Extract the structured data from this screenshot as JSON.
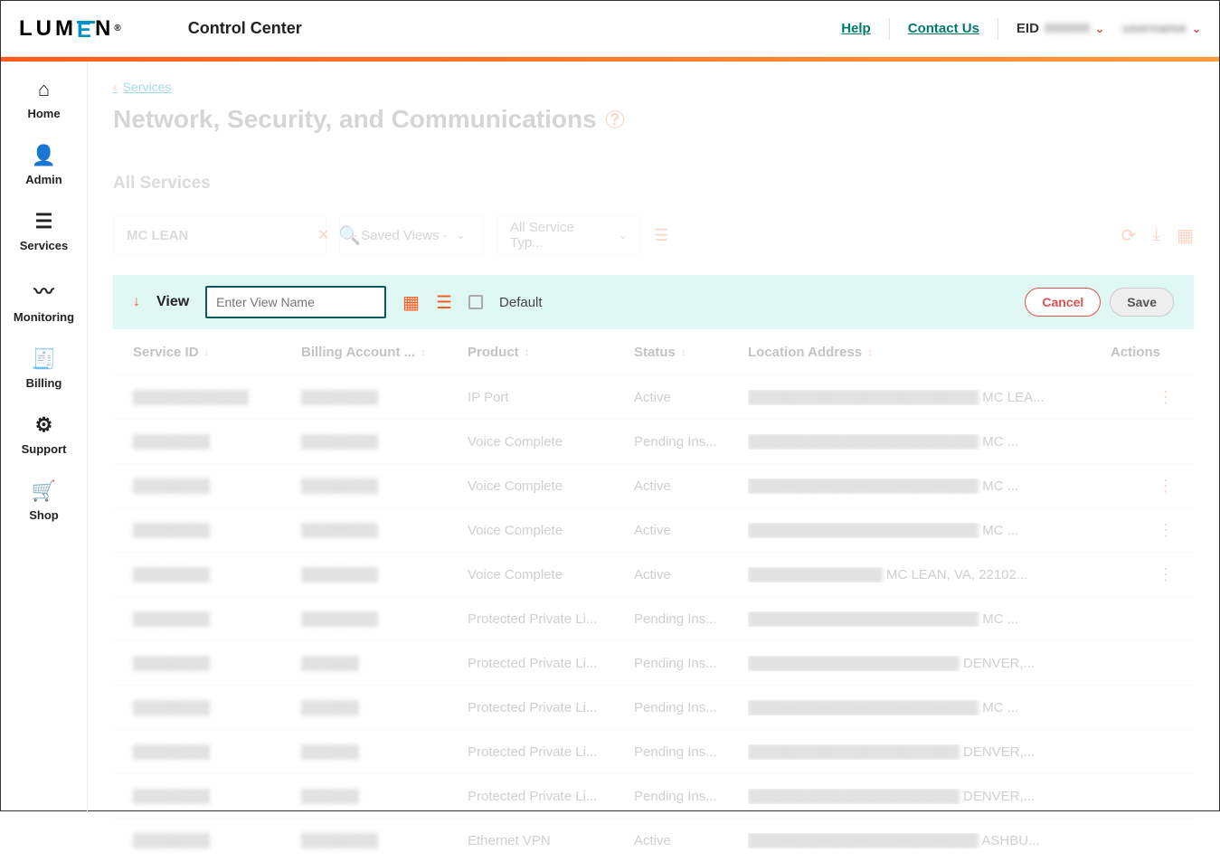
{
  "header": {
    "logo_pre": "LUM",
    "logo_mid": "E",
    "logo_post": "N",
    "app_title": "Control Center",
    "help": "Help",
    "contact": "Contact Us",
    "eid_label": "EID",
    "eid_value": "000000",
    "user_value": "username"
  },
  "sidebar": {
    "items": [
      {
        "icon": "⌂",
        "label": "Home"
      },
      {
        "icon": "👤",
        "label": "Admin"
      },
      {
        "icon": "☰",
        "label": "Services"
      },
      {
        "icon": "〰",
        "label": "Monitoring"
      },
      {
        "icon": "🧾",
        "label": "Billing"
      },
      {
        "icon": "⚙",
        "label": "Support"
      },
      {
        "icon": "🛒",
        "label": "Shop"
      }
    ]
  },
  "breadcrumb": "Services",
  "page_title": "Network, Security, and Communications",
  "section_title": "All Services",
  "filters": {
    "search_value": "MC LEAN",
    "saved_views": "- Saved Views -",
    "service_type": "All Service Typ..."
  },
  "view_bar": {
    "label": "View",
    "placeholder": "Enter View Name",
    "default": "Default",
    "cancel": "Cancel",
    "save": "Save"
  },
  "columns": {
    "sid": "Service ID",
    "ba": "Billing Account ...",
    "prod": "Product",
    "stat": "Status",
    "loc": "Location Address",
    "act": "Actions"
  },
  "rows": [
    {
      "sid": "████████████",
      "ba": "████████",
      "prod": "IP Port",
      "stat": "Active",
      "loc_blur": "████████████████████████",
      "loc": " MC LEA...",
      "dots": true
    },
    {
      "sid": "████████",
      "ba": "████████",
      "prod": "Voice Complete",
      "stat": "Pending Ins...",
      "loc_blur": "████████████████████████",
      "loc": " MC ...",
      "dots": false
    },
    {
      "sid": "████████",
      "ba": "████████",
      "prod": "Voice Complete",
      "stat": "Active",
      "loc_blur": "████████████████████████",
      "loc": " MC ...",
      "dots": true
    },
    {
      "sid": "████████",
      "ba": "████████",
      "prod": "Voice Complete",
      "stat": "Active",
      "loc_blur": "████████████████████████",
      "loc": " MC ...",
      "dots": true
    },
    {
      "sid": "████████",
      "ba": "████████",
      "prod": "Voice Complete",
      "stat": "Active",
      "loc_blur": "██████████████",
      "loc": " MC LEAN, VA, 22102...",
      "dots": true
    },
    {
      "sid": "████████",
      "ba": "████████",
      "prod": "Protected Private Li...",
      "stat": "Pending Ins...",
      "loc_blur": "████████████████████████",
      "loc": " MC ...",
      "dots": false
    },
    {
      "sid": "████████",
      "ba": "██████",
      "prod": "Protected Private Li...",
      "stat": "Pending Ins...",
      "loc_blur": "██████████████████████",
      "loc": " DENVER,...",
      "dots": false
    },
    {
      "sid": "████████",
      "ba": "██████",
      "prod": "Protected Private Li...",
      "stat": "Pending Ins...",
      "loc_blur": "████████████████████████",
      "loc": " MC ...",
      "dots": false
    },
    {
      "sid": "████████",
      "ba": "██████",
      "prod": "Protected Private Li...",
      "stat": "Pending Ins...",
      "loc_blur": "██████████████████████",
      "loc": " DENVER,...",
      "dots": false
    },
    {
      "sid": "████████",
      "ba": "██████",
      "prod": "Protected Private Li...",
      "stat": "Pending Ins...",
      "loc_blur": "██████████████████████",
      "loc": " DENVER,...",
      "dots": false
    },
    {
      "sid": "████████",
      "ba": "████████",
      "prod": "Ethernet VPN",
      "stat": "Active",
      "loc_blur": "████████████████████████",
      "loc": " ASHBU...",
      "dots": false
    }
  ]
}
